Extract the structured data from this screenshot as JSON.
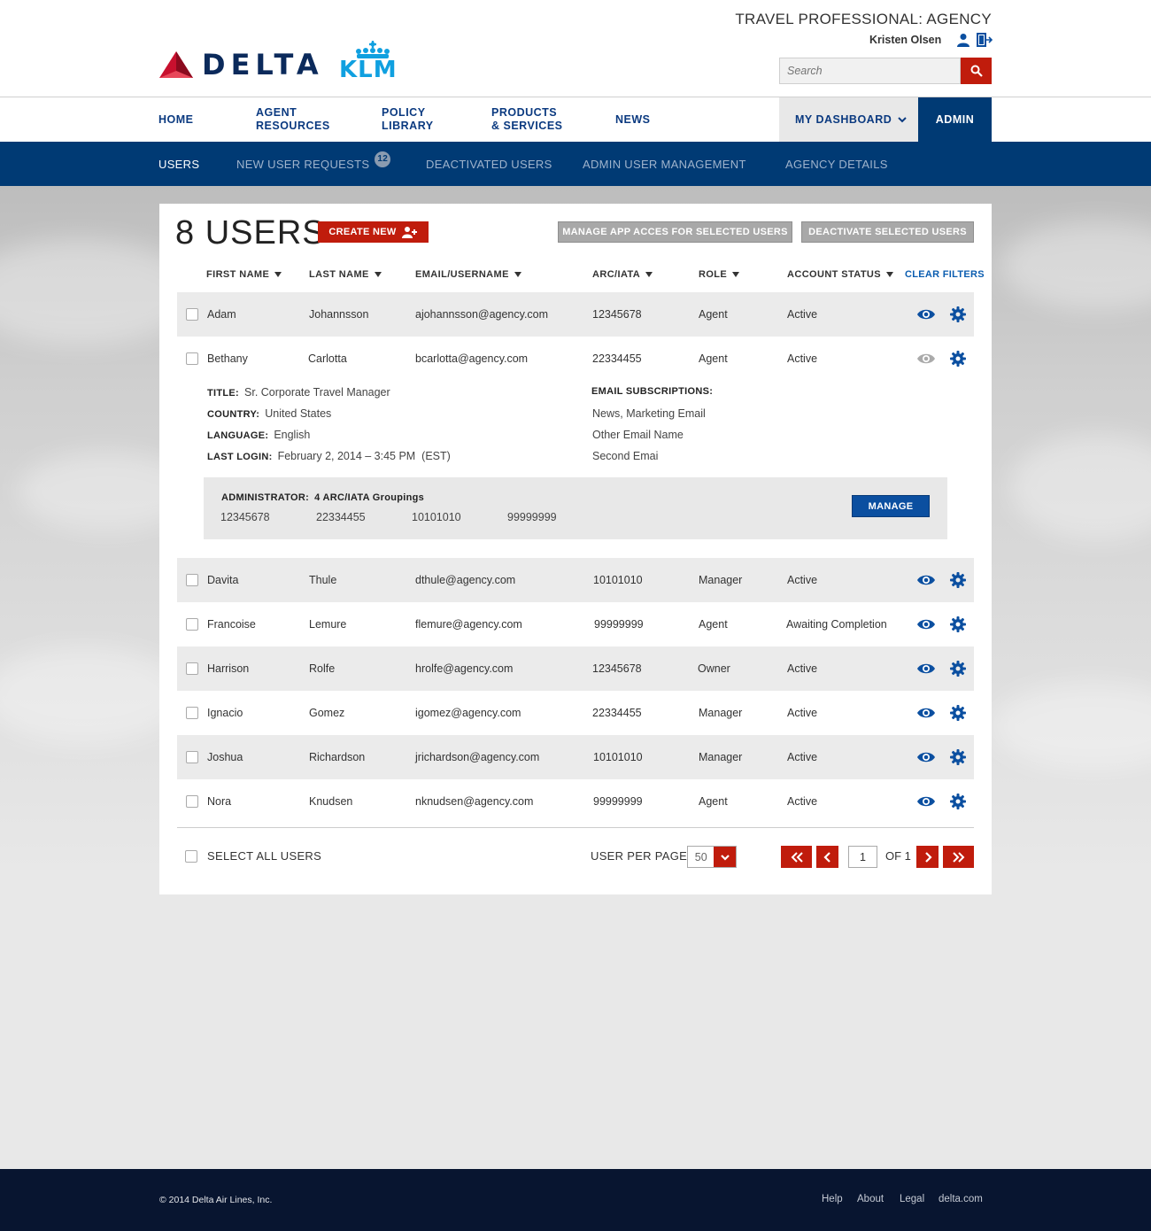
{
  "header": {
    "brand_name": "DELTA",
    "partner_name": "KLM",
    "account_title": "TRAVEL PROFESSIONAL: AGENCY",
    "user_name": "Kristen Olsen",
    "search_placeholder": "Search"
  },
  "nav": {
    "home": "HOME",
    "agent_resources": [
      "AGENT",
      "RESOURCES"
    ],
    "policy_library": [
      "POLICY",
      "LIBRARY"
    ],
    "products_services": [
      "PRODUCTS",
      "& SERVICES"
    ],
    "news": "NEWS",
    "my_dashboard": "MY DASHBOARD",
    "admin": "ADMIN"
  },
  "subnav": {
    "users": "USERS",
    "new_user_requests": "NEW USER REQUESTS",
    "new_user_requests_count": "12",
    "deactivated_users": "DEACTIVATED USERS",
    "admin_user_management": "ADMIN USER MANAGEMENT",
    "agency_details": "AGENCY DETAILS"
  },
  "panel": {
    "title": "8 USERS",
    "create_new": "CREATE NEW",
    "manage_app_access": "MANAGE APP ACCES FOR SELECTED USERS",
    "deactivate_selected": "DEACTIVATE SELECTED USERS",
    "columns": [
      "FIRST NAME",
      "LAST NAME",
      "EMAIL/USERNAME",
      "ARC/IATA",
      "ROLE",
      "ACCOUNT STATUS"
    ],
    "clear_filters": "CLEAR FILTERS"
  },
  "users": [
    {
      "first": "Adam",
      "last": "Johannsson",
      "email": "ajohannsson@agency.com",
      "arc": "12345678",
      "role": "Agent",
      "status": "Active"
    },
    {
      "first": "Bethany",
      "last": "Carlotta",
      "email": "bcarlotta@agency.com",
      "arc": "22334455",
      "role": "Agent",
      "status": "Active"
    },
    {
      "first": "Davita",
      "last": "Thule",
      "email": "dthule@agency.com",
      "arc": "10101010",
      "role": "Manager",
      "status": "Active"
    },
    {
      "first": "Francoise",
      "last": "Lemure",
      "email": "flemure@agency.com",
      "arc": "99999999",
      "role": "Agent",
      "status": "Awaiting Completion"
    },
    {
      "first": "Harrison",
      "last": "Rolfe",
      "email": "hrolfe@agency.com",
      "arc": "12345678",
      "role": "Owner",
      "status": "Active"
    },
    {
      "first": "Ignacio",
      "last": "Gomez",
      "email": "igomez@agency.com",
      "arc": "22334455",
      "role": "Manager",
      "status": "Active"
    },
    {
      "first": "Joshua",
      "last": "Richardson",
      "email": "jrichardson@agency.com",
      "arc": "10101010",
      "role": "Manager",
      "status": "Active"
    },
    {
      "first": "Nora",
      "last": "Knudsen",
      "email": "nknudsen@agency.com",
      "arc": "99999999",
      "role": "Agent",
      "status": "Active"
    }
  ],
  "detail": {
    "title_label": "TITLE:",
    "title_value": "Sr. Corporate Travel Manager",
    "country_label": "COUNTRY:",
    "country_value": "United States",
    "language_label": "LANGUAGE:",
    "language_value": "English",
    "last_login_label": "LAST LOGIN:",
    "last_login_value": "February 2, 2014 – 3:45 PM  (EST)",
    "subs_label": "EMAIL SUBSCRIPTIONS:",
    "subs": [
      "News, Marketing Email",
      "Other Email Name",
      "Second Emai"
    ],
    "admin_label": "ADMINISTRATOR:",
    "admin_value": "4 ARC/IATA Groupings",
    "groupings": [
      "12345678",
      "22334455",
      "10101010",
      "99999999"
    ],
    "manage": "MANAGE"
  },
  "pagination": {
    "select_all": "SELECT ALL USERS",
    "per_page_label": "USER PER PAGE",
    "per_page_value": "50",
    "page": "1",
    "of_label": "OF 1"
  },
  "footer": {
    "copyright": "© 2014 Delta Air Lines, Inc.",
    "links": [
      "Help",
      "About",
      "Legal",
      "delta.com"
    ]
  },
  "colors": {
    "brand_navy": "#003a74",
    "brand_red": "#c01c0c",
    "link_blue": "#0b5db0",
    "klm_blue": "#10a0e0",
    "footer": "#081530"
  }
}
